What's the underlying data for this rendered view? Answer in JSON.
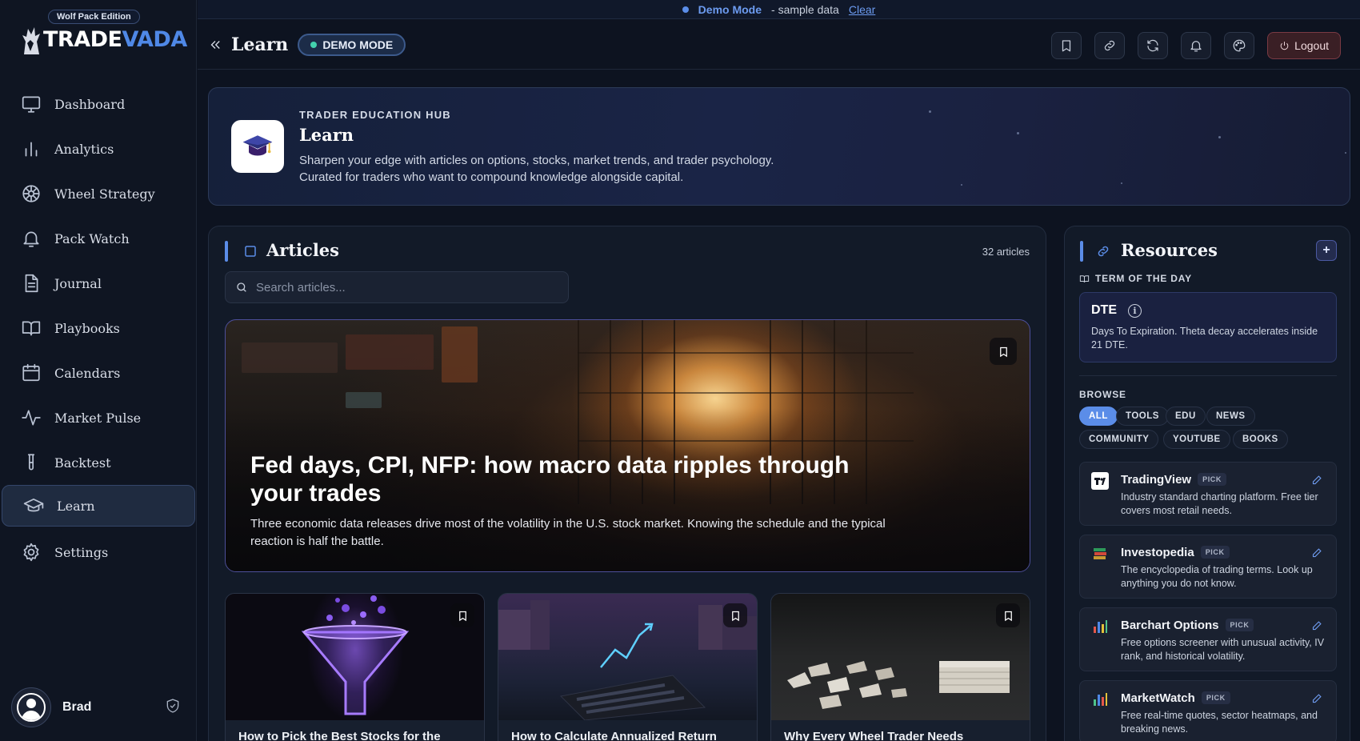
{
  "brand": {
    "edition": "Wolf Pack Edition",
    "name_a": "TRADE",
    "name_b": "VADA"
  },
  "sidebar": {
    "items": [
      {
        "label": "Dashboard",
        "icon": "monitor-icon"
      },
      {
        "label": "Analytics",
        "icon": "bar-chart-icon"
      },
      {
        "label": "Wheel Strategy",
        "icon": "wheel-icon"
      },
      {
        "label": "Pack Watch",
        "icon": "bell-icon"
      },
      {
        "label": "Journal",
        "icon": "document-icon"
      },
      {
        "label": "Playbooks",
        "icon": "book-icon"
      },
      {
        "label": "Calendars",
        "icon": "calendar-icon"
      },
      {
        "label": "Market Pulse",
        "icon": "pulse-icon"
      },
      {
        "label": "Backtest",
        "icon": "test-tube-icon"
      },
      {
        "label": "Learn",
        "icon": "graduation-cap-icon",
        "active": true
      },
      {
        "label": "Settings",
        "icon": "gear-icon"
      }
    ],
    "user": {
      "name": "Brad"
    }
  },
  "banner": {
    "mode": "Demo Mode",
    "sample": "- sample data",
    "clear": "Clear"
  },
  "header": {
    "title": "Learn",
    "badge": "DEMO MODE",
    "logout": "Logout"
  },
  "hero": {
    "kicker": "TRADER EDUCATION HUB",
    "title": "Learn",
    "line1": "Sharpen your edge with articles on options, stocks, market trends, and trader psychology.",
    "line2": "Curated for traders who want to compound knowledge alongside capital."
  },
  "articles": {
    "title": "Articles",
    "count": "32 articles",
    "search_placeholder": "Search articles...",
    "featured": {
      "title": "Fed days, CPI, NFP: how macro data ripples through your trades",
      "desc": "Three economic data releases drive most of the volatility in the U.S. stock market. Knowing the schedule and the typical reaction is half the battle."
    },
    "cards": [
      {
        "title": "How to Pick the Best Stocks for the"
      },
      {
        "title": "How to Calculate Annualized Return"
      },
      {
        "title": "Why Every Wheel Trader Needs"
      }
    ]
  },
  "resources": {
    "title": "Resources",
    "term_label": "TERM OF THE DAY",
    "term": {
      "name": "DTE",
      "def": "Days To Expiration. Theta decay accelerates inside 21 DTE."
    },
    "browse_label": "BROWSE",
    "chips": [
      "ALL",
      "TOOLS",
      "EDU",
      "NEWS",
      "COMMUNITY",
      "YOUTUBE",
      "BOOKS"
    ],
    "pick_label": "PICK",
    "items": [
      {
        "name": "TradingView",
        "desc": "Industry standard charting platform. Free tier covers most retail needs."
      },
      {
        "name": "Investopedia",
        "desc": "The encyclopedia of trading terms. Look up anything you do not know."
      },
      {
        "name": "Barchart Options",
        "desc": "Free options screener with unusual activity, IV rank, and historical volatility."
      },
      {
        "name": "MarketWatch",
        "desc": "Free real-time quotes, sector heatmaps, and breaking news."
      }
    ]
  },
  "colors": {
    "accent": "#5b8de8",
    "active_nav": "#1f2b40",
    "logout": "#3a1f25"
  }
}
